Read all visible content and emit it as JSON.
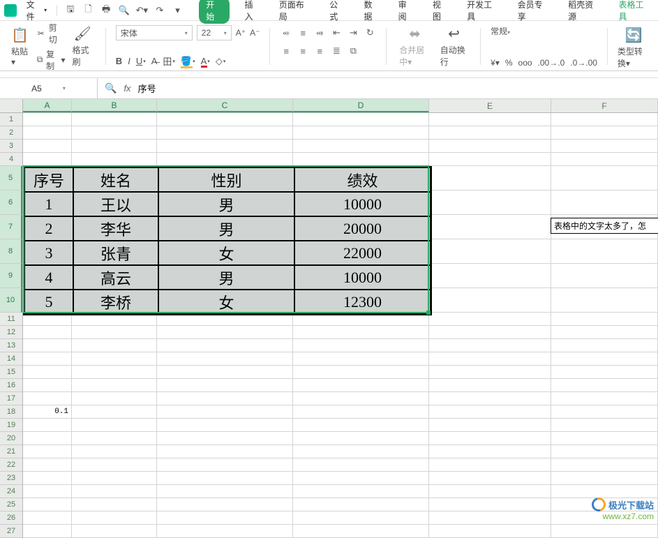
{
  "menu": {
    "file": "文件",
    "tabs": [
      "开始",
      "插入",
      "页面布局",
      "公式",
      "数据",
      "审阅",
      "视图",
      "开发工具",
      "会员专享",
      "稻壳资源",
      "表格工具"
    ],
    "active_tab_index": 0
  },
  "ribbon": {
    "paste": "粘贴",
    "cut": "剪切",
    "copy": "复制",
    "format_painter": "格式刷",
    "font_name": "宋体",
    "font_size": "22",
    "merge_center": "合并居中",
    "auto_wrap": "自动换行",
    "number_format": "常规",
    "type_convert": "类型转换"
  },
  "formula_bar": {
    "cell_ref": "A5",
    "content": "序号"
  },
  "columns": [
    "A",
    "B",
    "C",
    "D",
    "E",
    "F"
  ],
  "table": {
    "headers": [
      "序号",
      "姓名",
      "性别",
      "绩效"
    ],
    "rows": [
      [
        "1",
        "王以",
        "男",
        "10000"
      ],
      [
        "2",
        "李华",
        "男",
        "20000"
      ],
      [
        "3",
        "张青",
        "女",
        "22000"
      ],
      [
        "4",
        "高云",
        "男",
        "10000"
      ],
      [
        "5",
        "李桥",
        "女",
        "12300"
      ]
    ]
  },
  "cell_A18": "0.1",
  "note_text": "表格中的文字太多了，怎",
  "watermark": {
    "line1": "极光下载站",
    "line2": "www.xz7.com"
  }
}
